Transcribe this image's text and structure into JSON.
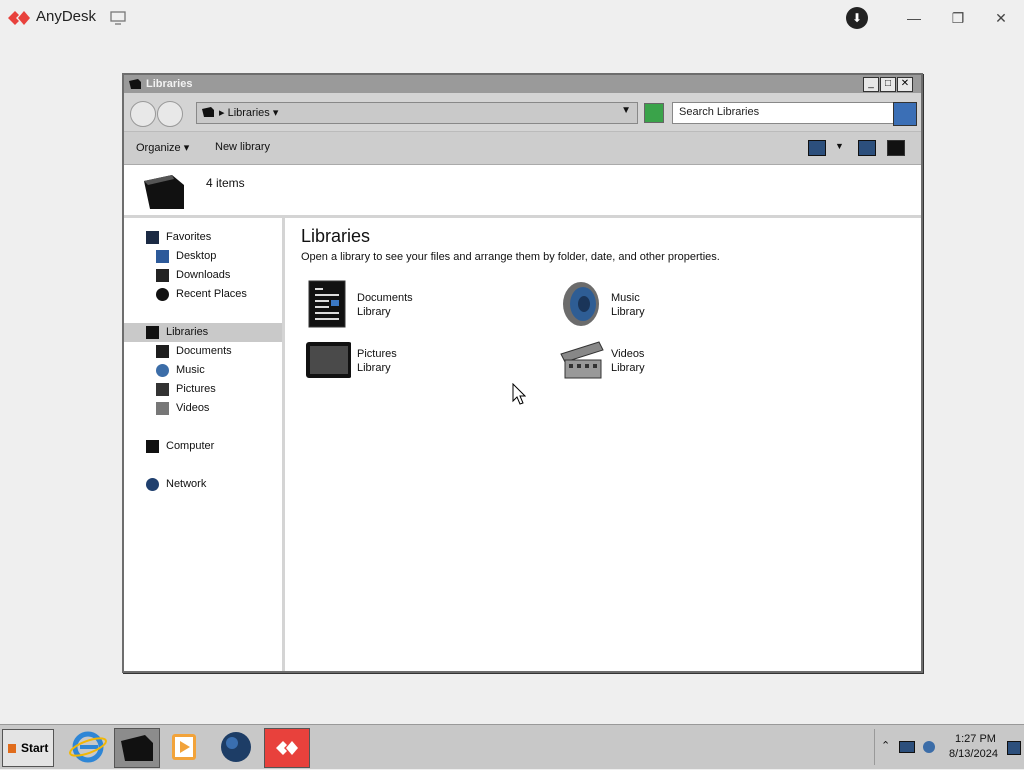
{
  "anydesk": {
    "title": "AnyDesk",
    "accent": "#e8413c",
    "controls": {
      "minimize": "—",
      "restore": "❐",
      "close": "✕"
    }
  },
  "window": {
    "title": "Libraries",
    "buttons": {
      "minimize": "_",
      "maximize": "□",
      "close": "✕"
    }
  },
  "address": {
    "breadcrumb": "Libraries",
    "search_placeholder": "Search Libraries"
  },
  "toolbar": {
    "organize": "Organize",
    "new_library": "New library"
  },
  "info": {
    "count": "4 items"
  },
  "sidebar": {
    "favorites": "Favorites",
    "desktop": "Desktop",
    "downloads": "Downloads",
    "recent_places": "Recent Places",
    "libraries": "Libraries",
    "documents": "Documents",
    "music": "Music",
    "pictures": "Pictures",
    "videos": "Videos",
    "computer": "Computer",
    "network": "Network"
  },
  "content": {
    "heading": "Libraries",
    "subheading": "Open a library to see your files and arrange them by folder, date, and other properties.",
    "libraries": [
      {
        "name": "Documents",
        "type": "Library",
        "icon": "documents-icon"
      },
      {
        "name": "Music",
        "type": "Library",
        "icon": "music-icon"
      },
      {
        "name": "Pictures",
        "type": "Library",
        "icon": "pictures-icon"
      },
      {
        "name": "Videos",
        "type": "Library",
        "icon": "videos-icon"
      }
    ]
  },
  "taskbar": {
    "start": "Start",
    "time": "1:27 PM",
    "date": "8/13/2024"
  }
}
